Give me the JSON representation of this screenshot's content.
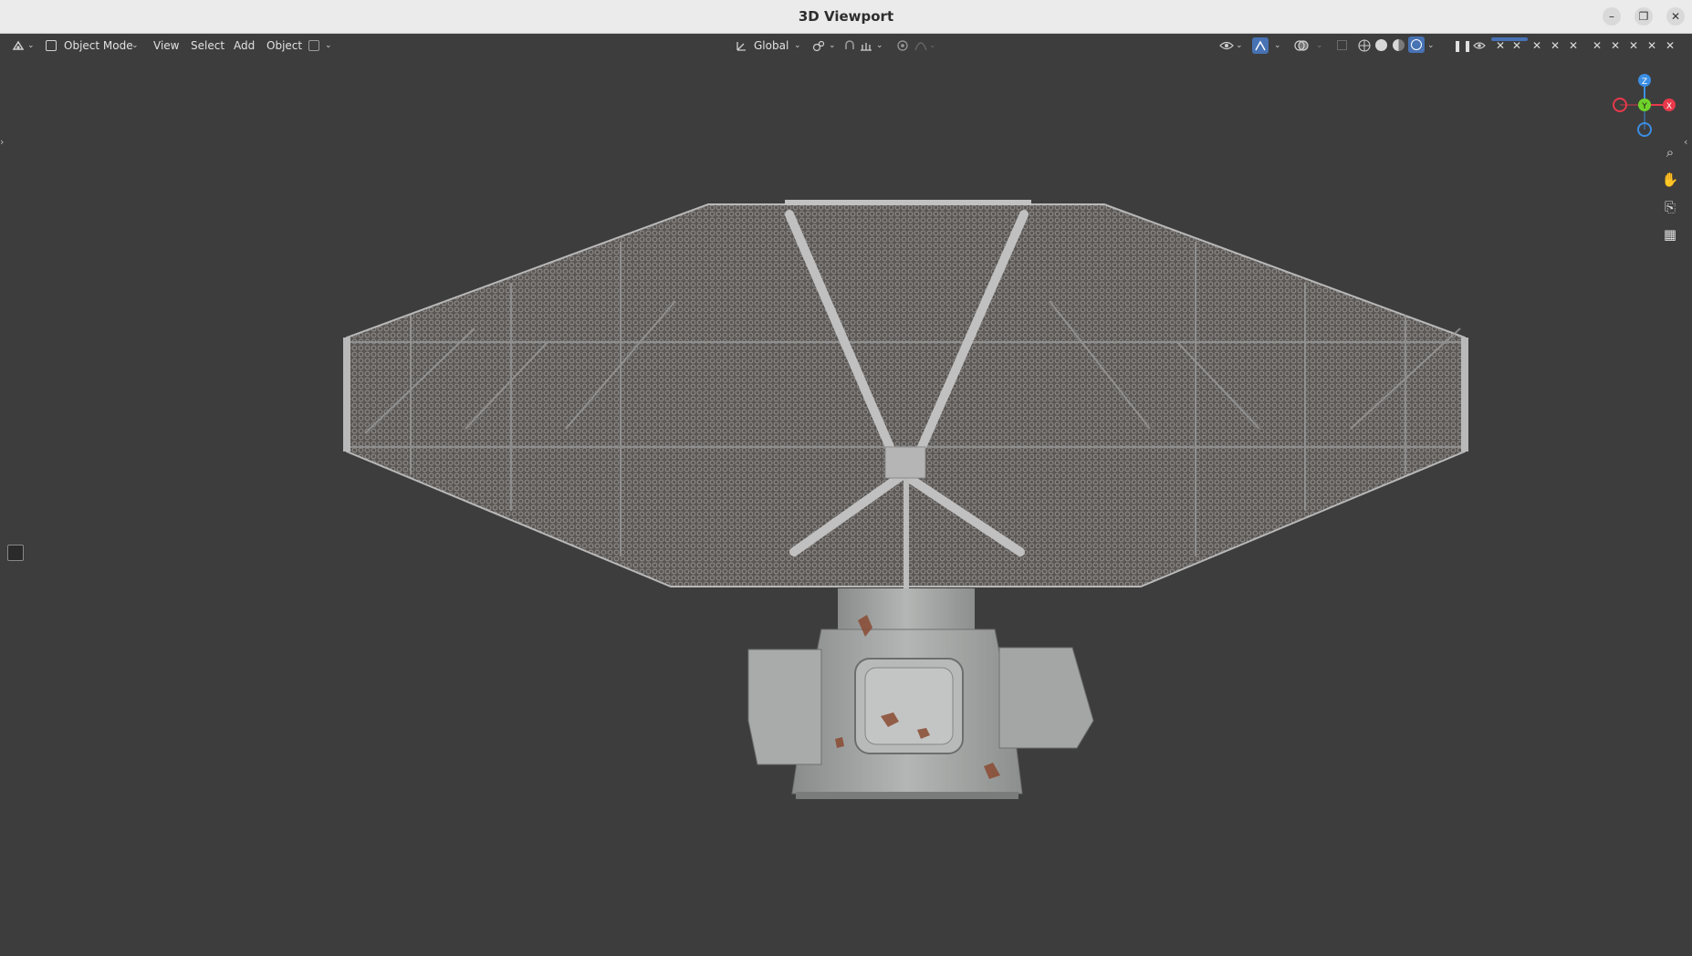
{
  "window": {
    "title": "3D Viewport",
    "minimize_glyph": "–",
    "restore_glyph": "❐",
    "close_glyph": "✕"
  },
  "header": {
    "mode_label": "Object Mode",
    "menus": [
      "View",
      "Select",
      "Add",
      "Object"
    ],
    "transform_orientation": "Global"
  },
  "icons": {
    "editor_type": "editor-type-icon",
    "mode": "object-mode-icon",
    "transform_orientation": "transform-orientation-icon",
    "pivot": "pivot-point-icon",
    "snap": "snap-icon",
    "snap_target": "snap-increment-icon",
    "proportional": "proportional-editing-icon",
    "falloff": "falloff-icon",
    "visibility": "visibility-icon",
    "gizmos": "gizmos-icon",
    "overlays": "overlays-icon",
    "xray": "xray-icon",
    "shading_wire": "wireframe-shading-icon",
    "shading_solid": "solid-shading-icon",
    "shading_material": "material-preview-icon",
    "shading_rendered": "rendered-shading-icon",
    "pause": "pause-icon",
    "eye": "eye-icon"
  },
  "navigation_gizmo": {
    "axes": [
      "Z",
      "Y",
      "X"
    ],
    "colors": {
      "x": "#e8394b",
      "y": "#6fd32a",
      "z": "#3b8ee3"
    }
  },
  "nav_buttons": [
    "zoom-icon",
    "hand-pan-icon",
    "camera-icon",
    "grid-perspective-icon"
  ],
  "colors": {
    "viewport_bg": "#3d3d3d",
    "titlebar_bg": "#ebebeb",
    "accent_blue": "#4772b3"
  }
}
